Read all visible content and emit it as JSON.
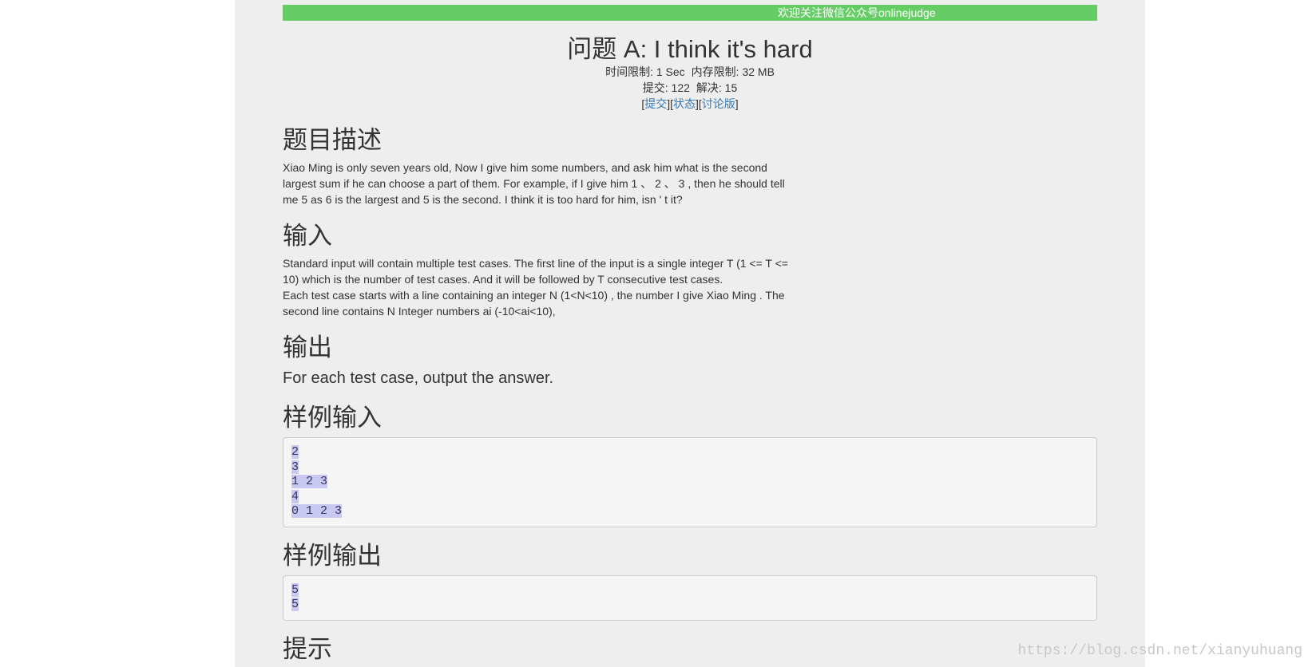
{
  "notice": "欢迎关注微信公众号onlinejudge",
  "title": "问题 A: I think it's hard",
  "meta": {
    "time_limit": "时间限制: 1 Sec",
    "memory_limit": "内存限制: 32 MB",
    "submitted": "提交: 122",
    "solved": "解决: 15"
  },
  "links": {
    "open": "[",
    "submit": "提交",
    "sep1": "][",
    "status": "状态",
    "sep2": "][",
    "discuss": "讨论版",
    "close": "]"
  },
  "sections": {
    "description": {
      "heading": "题目描述",
      "lines": [
        "Xiao Ming is only seven years old, Now I give him some numbers, and ask him what is the second",
        "largest sum if he can choose a part of them. For example, if I give him 1 、 2 、 3 ,   then he should tell",
        "me 5 as 6 is the largest and 5 is the second. I think it is too hard for him, isn ' t it?"
      ]
    },
    "input": {
      "heading": "输入",
      "lines": [
        "Standard input will contain multiple test cases. The first line of the input is a single integer T (1 <= T <=",
        "10) which is the number of test cases. And it will be followed by T consecutive test cases.",
        "Each test case starts with a line containing an integer N (1<N<10) , the number I give Xiao Ming . The",
        "second line contains N Integer numbers ai (-10<ai<10),"
      ]
    },
    "output": {
      "heading": "输出",
      "text": "For each test case, output the answer."
    },
    "sample_input": {
      "heading": "样例输入",
      "lines": [
        "2",
        "3",
        "1 2 3",
        "4",
        "0 1 2 3"
      ]
    },
    "sample_output": {
      "heading": "样例输出",
      "lines": [
        "5",
        "5"
      ]
    },
    "hint": {
      "heading": "提示"
    }
  },
  "watermark": "https://blog.csdn.net/xianyuhuang",
  "colors": {
    "notice_bar": "#66cc66",
    "link": "#337ab7",
    "selection": "#c8c8f2",
    "page_bg": "#eeeeee"
  }
}
